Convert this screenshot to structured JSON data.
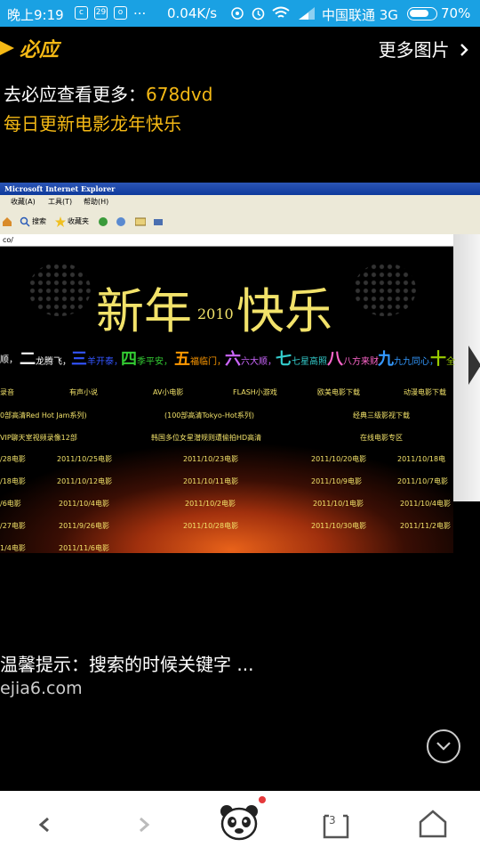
{
  "status_bar": {
    "time": "晚上9:19",
    "dots": "...",
    "speed": "0.04K/s",
    "carrier": "中国联通 3G",
    "battery": "70%",
    "icons": [
      "app-icon",
      "calendar-icon",
      "app-icon",
      "nfc-icon",
      "alarm-icon",
      "wifi-icon",
      "signal-icon",
      "battery-icon"
    ]
  },
  "header": {
    "brand": "必应",
    "more_label": "更多图片",
    "line1_prefix": "去必应查看更多：",
    "line1_code": "678dvd",
    "line2": "每日更新电影龙年快乐"
  },
  "screenshot": {
    "window_title": "Microsoft Internet Explorer",
    "menu": [
      "收藏(A)",
      "工具(T)",
      "帮助(H)"
    ],
    "toolbar": [
      "搜索",
      "收藏夹"
    ],
    "address": "co/",
    "greeting_left": "新年",
    "greeting_year": "2010",
    "greeting_right": "快乐",
    "wishes": [
      {
        "big": "二",
        "small": "龙腾飞，",
        "color": "#ffffff"
      },
      {
        "big": "三",
        "small": "羊开泰，",
        "color": "#3355ff"
      },
      {
        "big": "四",
        "small": "季平安，",
        "color": "#33cc33"
      },
      {
        "big": "五",
        "small": "福临门，",
        "color": "#ff9900"
      },
      {
        "big": "六",
        "small": "六大顺，",
        "color": "#cc66ff"
      },
      {
        "big": "七",
        "small": "七星高照，",
        "color": "#33cccc"
      },
      {
        "big": "八",
        "small": "八方来财，",
        "color": "#ff66cc"
      },
      {
        "big": "九",
        "small": "九九同心，",
        "color": "#3399ff"
      },
      {
        "big": "十",
        "small": "全",
        "color": "#99cc00"
      }
    ],
    "wish_first": "顺，",
    "row1": [
      "录音",
      "有声小说",
      "AV小电影",
      "FLASH小游戏",
      "欧美电影下载",
      "动漫电影下载"
    ],
    "row2": [
      "0部高清Red Hot Jam系列)",
      "(100部高清Tokyo-Hot系列)",
      "经典三级影视下载"
    ],
    "row3": [
      "VIP聊天室视频录像12部",
      "韩国多位女星潜规则遭偷拍HD高清",
      "在线电影专区"
    ],
    "row4": [
      "/28电影",
      "2011/10/25电影",
      "2011/10/23电影",
      "2011/10/20电影",
      "2011/10/18电"
    ],
    "row5": [
      "/18电影",
      "2011/10/12电影",
      "2011/10/11电影",
      "2011/10/9电影",
      "2011/10/7电影"
    ],
    "row6": [
      "/6电影",
      "2011/10/4电影",
      "2011/10/2电影",
      "2011/10/1电影",
      "2011/10/4电影"
    ],
    "row7": [
      "/27电影",
      "2011/9/26电影",
      "2011/10/28电影",
      "2011/10/30电影",
      "2011/11/2电影"
    ],
    "row8": [
      "1/4电影",
      "2011/11/6电影"
    ]
  },
  "caption": {
    "text": "温馨提示：搜索的时候关键字 ...",
    "domain": "ejia6.com"
  },
  "bottom_nav": {
    "tab_count": "3",
    "icons": [
      "back-icon",
      "forward-icon",
      "panda-icon",
      "tabs-icon",
      "home-icon"
    ]
  }
}
